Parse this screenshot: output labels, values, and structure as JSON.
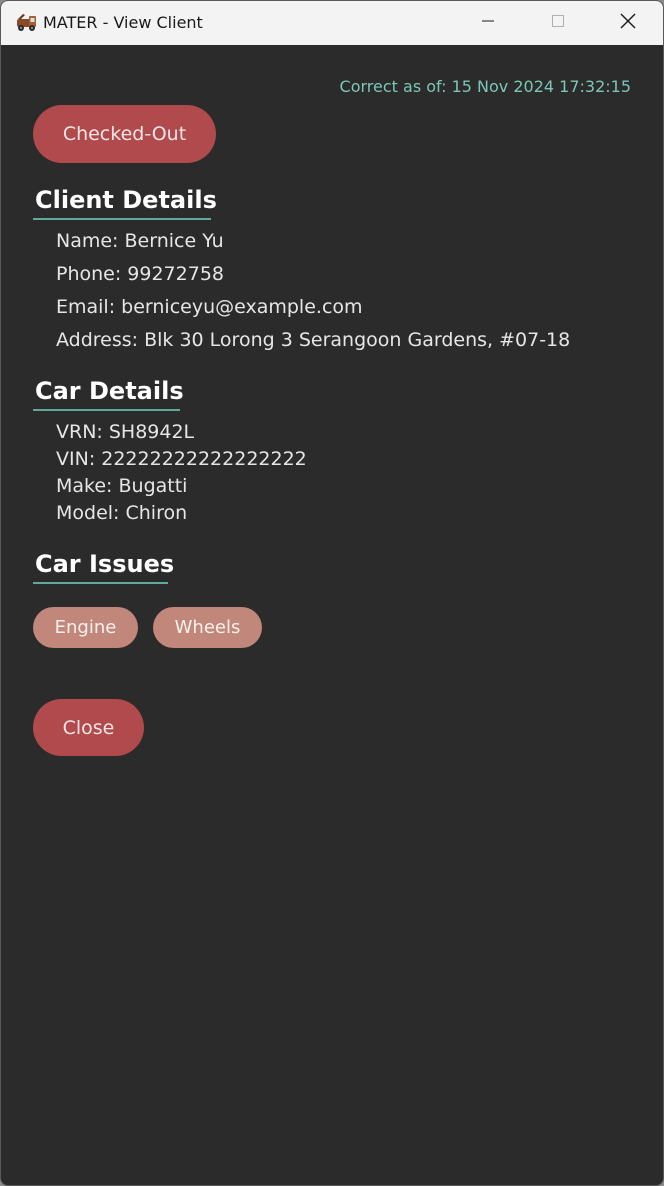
{
  "window": {
    "title": "MATER - View Client"
  },
  "header": {
    "timestamp": "Correct as of: 15 Nov 2024 17:32:15",
    "status_button": "Checked-Out"
  },
  "client_details": {
    "title": "Client Details",
    "name": "Name: Bernice Yu",
    "phone": "Phone: 99272758",
    "email": "Email: berniceyu@example.com",
    "address": "Address: Blk 30 Lorong 3 Serangoon Gardens, #07-18"
  },
  "car_details": {
    "title": "Car Details",
    "vrn": "VRN: SH8942L",
    "vin": "VIN: 22222222222222222",
    "make": "Make: Bugatti",
    "model": "Model: Chiron"
  },
  "car_issues": {
    "title": "Car Issues",
    "items": [
      "Engine",
      "Wheels"
    ]
  },
  "footer": {
    "close_button": "Close"
  },
  "colors": {
    "accent_red": "#b04a4c",
    "chip": "#c0877a",
    "teal": "#7cc6b8",
    "background": "#2b2b2b"
  },
  "icons": {
    "app": "tow-truck-icon",
    "minimize": "minimize-icon",
    "maximize": "maximize-icon",
    "close": "close-icon"
  }
}
